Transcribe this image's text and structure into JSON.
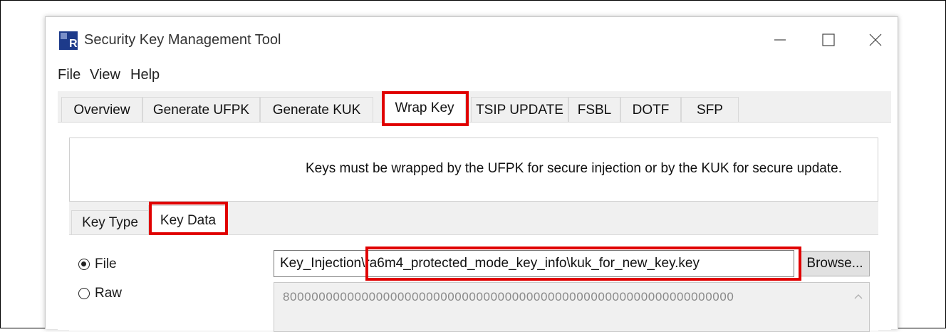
{
  "window": {
    "title": "Security Key Management Tool",
    "app_icon_letter": "R",
    "controls": {
      "minimize": "minimize-icon",
      "maximize": "maximize-icon",
      "close": "close-icon"
    }
  },
  "menu": {
    "items": [
      {
        "label": "File"
      },
      {
        "label": "View"
      },
      {
        "label": "Help"
      }
    ]
  },
  "tabs": {
    "items": [
      {
        "label": "Overview"
      },
      {
        "label": "Generate UFPK"
      },
      {
        "label": "Generate KUK"
      },
      {
        "label": "Wrap Key"
      },
      {
        "label": "TSIP UPDATE"
      },
      {
        "label": "FSBL"
      },
      {
        "label": "DOTF"
      },
      {
        "label": "SFP"
      }
    ],
    "active": "Wrap Key"
  },
  "wrap_key": {
    "info": "Keys must be wrapped by the UFPK for secure injection or by the KUK for secure update.",
    "subtabs": {
      "items": [
        {
          "label": "Key Type"
        },
        {
          "label": "Key Data"
        }
      ],
      "active": "Key Data"
    },
    "source": {
      "file_label": "File",
      "raw_label": "Raw",
      "selected": "File"
    },
    "file_path": "Key_Injection\\ra6m4_protected_mode_key_info\\kuk_for_new_key.key",
    "browse_label": "Browse...",
    "raw_value": "800000000000000000000000000000000000000000000000000000000000000"
  },
  "colors": {
    "highlight": "#e00000",
    "panel_bg": "#f0f0f0",
    "button_bg": "#e1e1e1"
  }
}
